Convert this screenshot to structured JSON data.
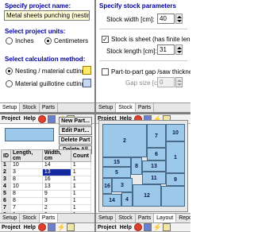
{
  "setup": {
    "project_name_heading": "Specify project name:",
    "project_name": "Metal sheets punching (nesting metho",
    "units_heading": "Select project units:",
    "units": [
      "Inches",
      "Centimeters"
    ],
    "method_heading": "Select calculation method:",
    "methods": [
      "Nesting / material cutting",
      "Material guillotine cutting"
    ]
  },
  "stock": {
    "heading": "Specify stock parameters",
    "width_label": "Stock width [cm]:",
    "width_value": "40",
    "is_sheet_label": "Stock is sheet (has finite length)",
    "length_label": "Stock length [cm]:",
    "length_value": "31",
    "gap_check_label": "Part-to-part gap /saw thickness",
    "gap_label": "Gap size [cm]:",
    "gap_value": "0"
  },
  "tabs_top_left": [
    "Setup",
    "Stock",
    "Parts"
  ],
  "tabs_top_right": [
    "Setup",
    "Stock",
    "Parts"
  ],
  "tabs_bottom_left": [
    "Setup",
    "Stock",
    "Parts"
  ],
  "tabs_bottom_right": [
    "Setup",
    "Stock",
    "Parts",
    "Layout",
    "Report"
  ],
  "menu": {
    "project": "Project",
    "help": "Help"
  },
  "part_buttons": [
    "New Part...",
    "Edit Part...",
    "Delete Part",
    "Delete All"
  ],
  "parts_table": {
    "columns": [
      "ID",
      "Length, cm",
      "Width, cm",
      "Count"
    ],
    "rows": [
      [
        "1",
        "10",
        "14",
        "1"
      ],
      [
        "2",
        "3",
        "13",
        "1"
      ],
      [
        "3",
        "8",
        "16",
        "1"
      ],
      [
        "4",
        "10",
        "13",
        "1"
      ],
      [
        "5",
        "8",
        "9",
        "1"
      ],
      [
        "6",
        "8",
        "3",
        "1"
      ],
      [
        "7",
        "7",
        "2",
        "1"
      ],
      [
        "8",
        "1",
        "9",
        "1"
      ],
      [
        "9",
        "9",
        "6",
        "1"
      ]
    ],
    "selected_row": 1
  },
  "layout_parts": [
    "2",
    "7",
    "10",
    "1",
    "6",
    "15",
    "8",
    "13",
    "5",
    "11",
    "9",
    "16",
    "3",
    "4",
    "12",
    "14"
  ],
  "colors": {
    "heading": "#0000a0",
    "part_fill": "#9cc8ea",
    "field_bg": "#fffdd8",
    "selection": "#1428a0"
  }
}
